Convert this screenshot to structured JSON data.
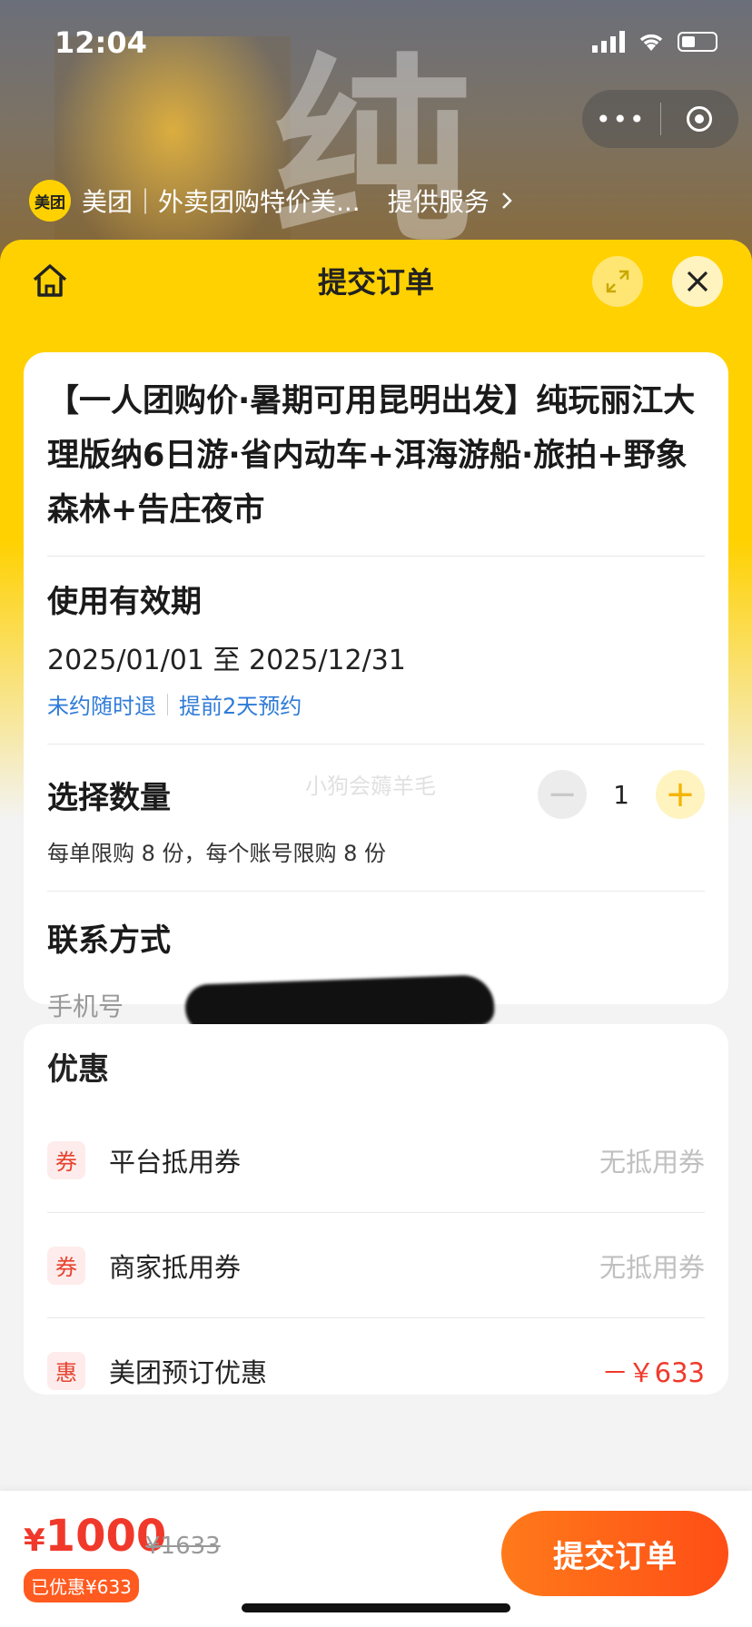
{
  "status_bar": {
    "time": "12:04"
  },
  "mini_app": {
    "logo_text": "美团",
    "title": "美团｜外卖团购特价美...",
    "service_link": "提供服务"
  },
  "header": {
    "title": "提交订单"
  },
  "product": {
    "title": "【一人团购价·暑期可用昆明出发】纯玩丽江大理版纳6日游·省内动车+洱海游船·旅拍+野象森林+告庄夜市"
  },
  "validity": {
    "label": "使用有效期",
    "range": "2025/01/01 至 2025/12/31",
    "tags": [
      "未约随时退",
      "提前2天预约"
    ]
  },
  "quantity": {
    "label": "选择数量",
    "value": "1",
    "minus": "−",
    "plus": "+",
    "limit_text": "每单限购 8 份，每个账号限购 8 份"
  },
  "watermark": "小狗会薅羊毛",
  "contact": {
    "label": "联系方式",
    "phone_label": "手机号"
  },
  "discounts": {
    "title": "优惠",
    "items": [
      {
        "badge": "券",
        "label": "平台抵用券",
        "value": "无抵用券"
      },
      {
        "badge": "券",
        "label": "商家抵用券",
        "value": "无抵用券"
      },
      {
        "badge": "惠",
        "label": "美团预订优惠",
        "value": "－￥633"
      }
    ]
  },
  "footer": {
    "currency": "¥",
    "price": "1000",
    "original_price": "¥1633",
    "saved": "已优惠¥633",
    "submit": "提交订单"
  },
  "colors": {
    "brand_yellow": "#ffd100",
    "accent_orange": "#ff5a1f",
    "price_red": "#f0392b",
    "link_blue": "#2f7bd8"
  }
}
